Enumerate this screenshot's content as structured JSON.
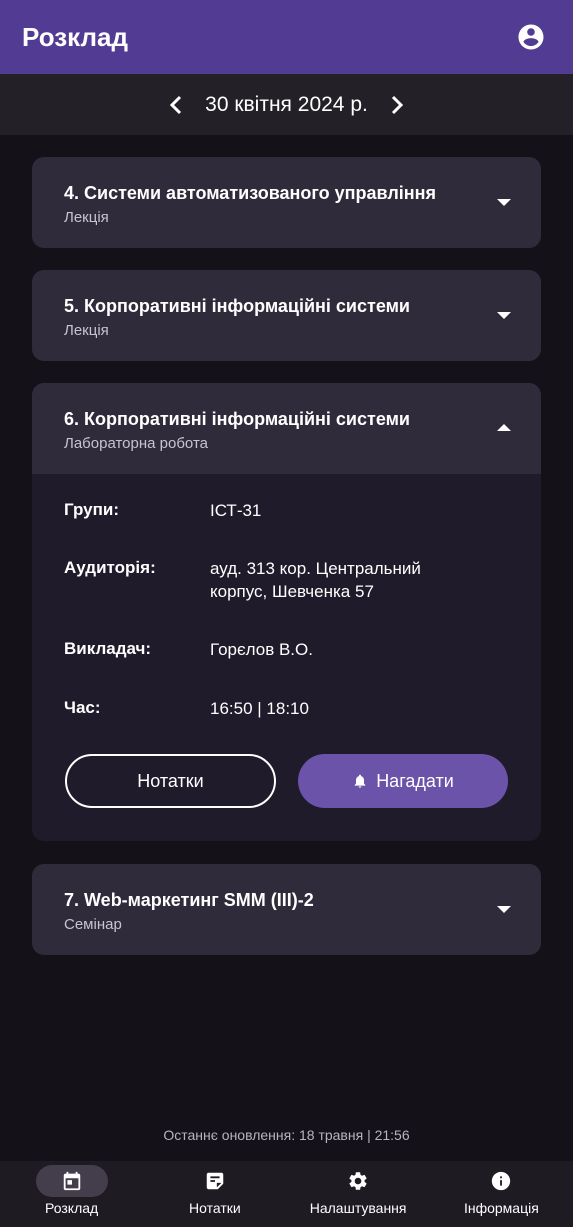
{
  "app_bar": {
    "title": "Розклад",
    "profile_icon": "account-circle-icon"
  },
  "date_nav": {
    "date": "30 квітня 2024 р."
  },
  "lessons": [
    {
      "name": "4. Системи автоматизованого управління",
      "type": "Лекція",
      "expanded": false
    },
    {
      "name": "5. Корпоративні інформаційні системи",
      "type": "Лекція",
      "expanded": false
    },
    {
      "name": "6. Корпоративні інформаційні системи",
      "type": "Лабораторна робота",
      "expanded": true,
      "details": {
        "groups_label": "Групи:",
        "groups": "ІСТ-31",
        "room_label": "Аудиторія:",
        "room_line1": "ауд. 313 кор. Центральний",
        "room_line2": "корпус, Шевченка 57",
        "teacher_label": "Викладач:",
        "teacher": "Горєлов В.О.",
        "time_label": "Час:",
        "time": "16:50 | 18:10"
      },
      "notes_button": "Нотатки",
      "remind_button": "Нагадати"
    },
    {
      "name": "7. Web-маркетинг SMM (III)-2",
      "type": "Семінар",
      "expanded": false
    }
  ],
  "last_update": "Останнє оновлення: 18 травня | 21:56",
  "bottom_nav": {
    "items": [
      {
        "label": "Розклад",
        "icon": "calendar-icon",
        "active": true
      },
      {
        "label": "Нотатки",
        "icon": "note-icon",
        "active": false
      },
      {
        "label": "Налаштування",
        "icon": "gear-icon",
        "active": false
      },
      {
        "label": "Інформація",
        "icon": "info-icon",
        "active": false
      }
    ]
  },
  "colors": {
    "app_bar": "#523b92",
    "accent_button": "#6b53a9",
    "background": "#141118",
    "card": "#302b3b"
  }
}
